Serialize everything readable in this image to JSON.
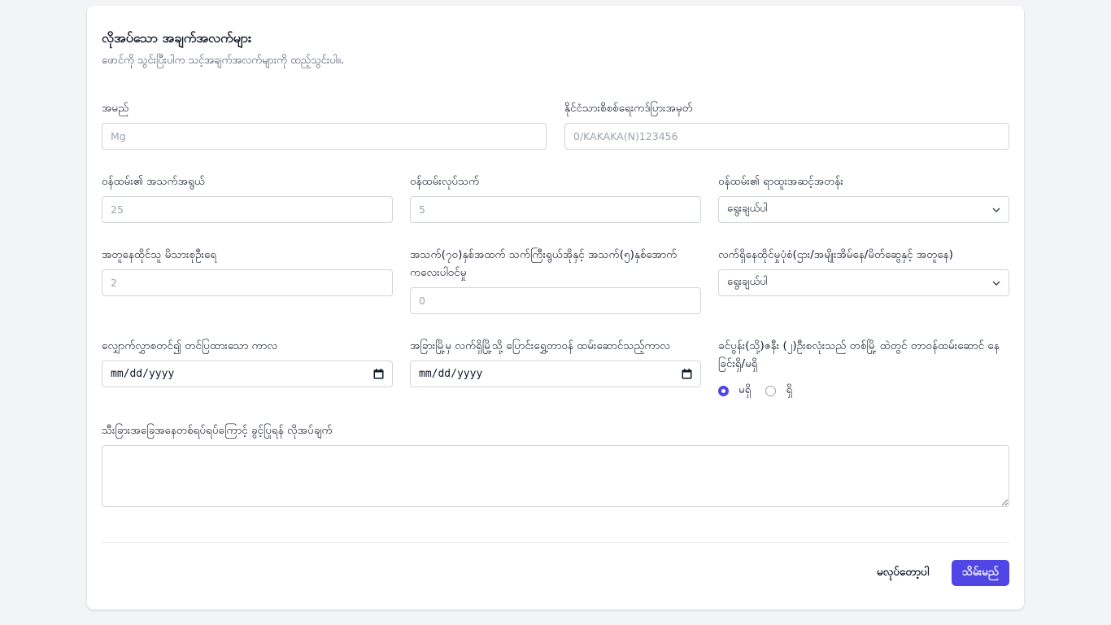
{
  "form": {
    "title": "လိုအပ်သော အချက်အလက်များ",
    "subtitle": "ဖောင်ကို သွင်းပြီးပါက သင့်အချက်အလက်များကို ထည့်သွင်းပါ။.",
    "name": {
      "label": "အမည်",
      "placeholder": "Mg"
    },
    "nrc": {
      "label": "နိုင်ငံသားစိစစ်ရေးကဒ်ပြားအမှတ်",
      "placeholder": "0/KAKAKA(N)123456"
    },
    "employee_age": {
      "label": "ဝန်ထမ်း၏ အသက်အရွယ်",
      "placeholder": "25"
    },
    "service_years": {
      "label": "ဝန်ထမ်းလုပ်သက်",
      "placeholder": "5"
    },
    "rank": {
      "label": "ဝန်ထမ်း၏ ရာထူးအဆင့်အတန်း",
      "value": "ရွေးချယ်ပါ"
    },
    "children_count": {
      "label": "အတူနေထိုင်သူ မိသားစုဦးရေ",
      "placeholder": "2"
    },
    "dependents": {
      "label": "အသက်(၇၀)နှစ်အထက် သက်ကြီးရွယ်အိုနှင့် အသက်(၅)နှစ်အောက် ကလေးပါဝင်မှု",
      "placeholder": "0"
    },
    "living_status": {
      "label": "လက်ရှိနေထိုင်မှုပုံစံ(ဌား/အမျိုးအိမ်နေ/မိတ်ဆွေနှင့် အတူနေ)",
      "value": "ရွေးချယ်ပါ"
    },
    "apply_date": {
      "label": "လျှောက်လွှာစတင်၍ တင်ပြထားသော ကာလ",
      "value": "mm/dd/yyyy"
    },
    "transfer_date": {
      "label": "အခြားမြို့မှ လက်ရှိမြို့သို့ ပြောင်းရွှေ့တာဝန် ထမ်းဆောင်သည့်ကာလ",
      "value": "mm/dd/yyyy"
    },
    "spouse": {
      "label": "ခင်ပွန်း(သို့)ဇနီး (၂)ဦးစလုံးသည် တစ်မြို့ ထဲတွင် တာဝန်ထမ်းဆောင် နေခြင်းရှိ/မရှိ",
      "options": [
        "မရှိ",
        "ရှိ"
      ],
      "selected": "မရှိ"
    },
    "special": {
      "label": "သီးခြားအခြေအနေတစ်ရပ်ရပ်ကြောင့် ခွင့်ပြုရန် လိုအပ်ချက်"
    },
    "cancel_label": "မလုပ်တော့ပါ",
    "save_label": "သိမ်းမည်"
  },
  "colors": {
    "accent": "#4f46e5",
    "border": "#d1d5db",
    "page_bg": "#f3f4f6"
  }
}
